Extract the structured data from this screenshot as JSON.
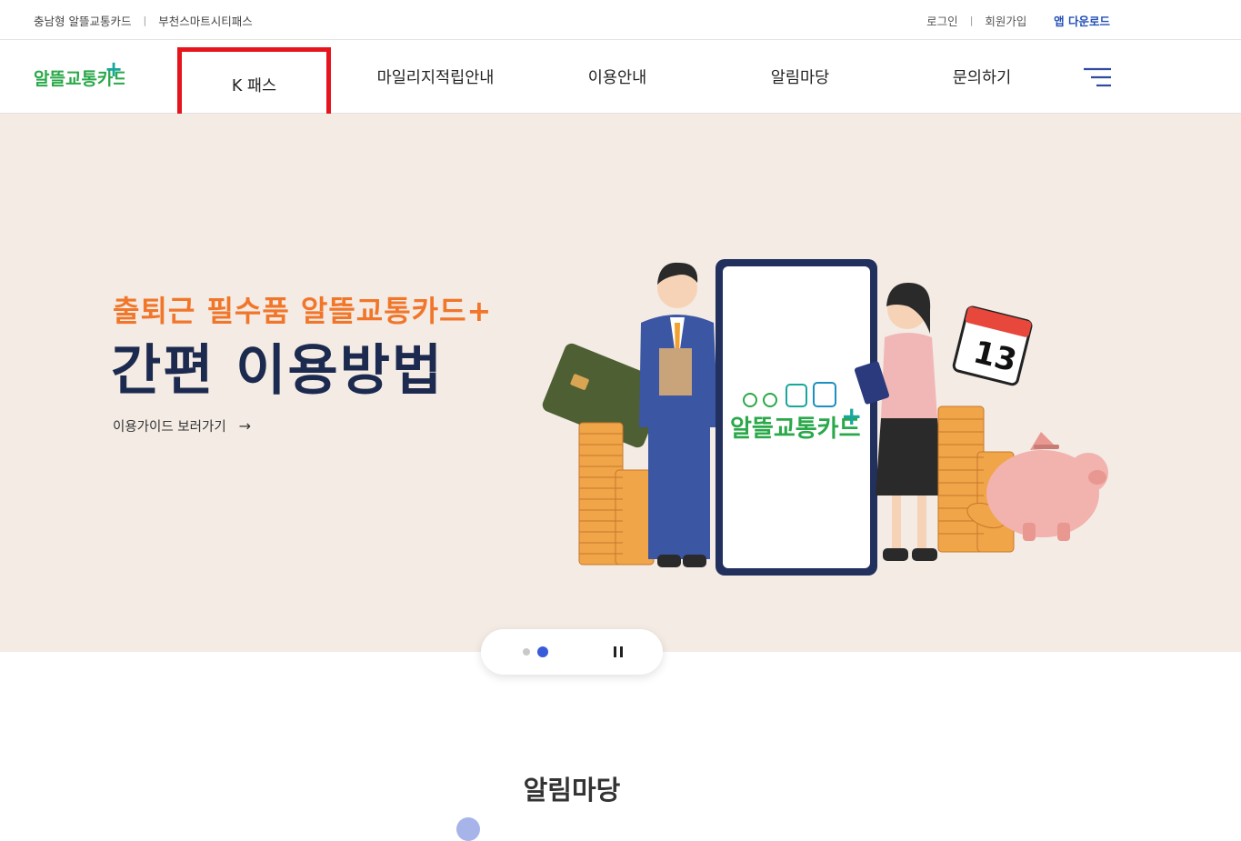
{
  "topbar": {
    "links_left": [
      "충남형 알뜰교통카드",
      "부천스마트시티패스"
    ],
    "login": "로그인",
    "signup": "회원가입",
    "app_download": "앱 다운로드"
  },
  "logo": {
    "text": "알뜰교통카드",
    "plus": "+"
  },
  "gnb": {
    "items": [
      "K 패스",
      "마일리지적립안내",
      "이용안내",
      "알림마당",
      "문의하기"
    ]
  },
  "hero": {
    "subtitle": "출퇴근 필수품 알뜰교통카드+",
    "title": "간편 이용방법",
    "guide_link": "이용가이드 보러가기",
    "guide_arrow": "→",
    "phone_logo": "알뜰교통카드",
    "calendar_day": "13"
  },
  "slider": {
    "total_slides": 2,
    "active_slide": 2
  },
  "notice": {
    "title": "알림마당"
  },
  "colors": {
    "accent_orange": "#f2762a",
    "title_navy": "#1d2a4f",
    "brand_green": "#2aa84a",
    "brand_teal": "#18a79b",
    "highlight_red": "#e6141c",
    "hero_bg": "#f3ebe4",
    "link_blue": "#2350b8"
  }
}
